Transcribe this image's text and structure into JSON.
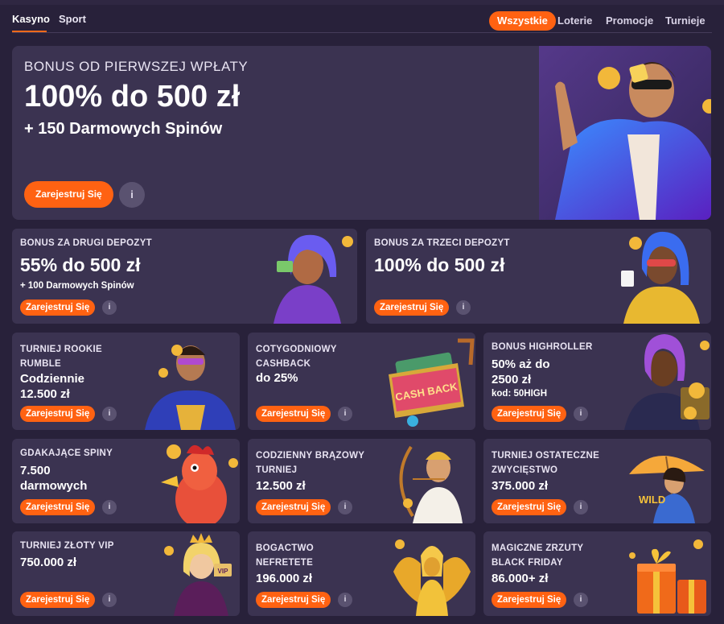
{
  "nav": {
    "tabs": [
      {
        "label": "Kasyno",
        "active": true
      },
      {
        "label": "Sport",
        "active": false
      }
    ],
    "filters": [
      {
        "label": "Wszystkie",
        "active": true
      },
      {
        "label": "Loterie",
        "active": false
      },
      {
        "label": "Promocje",
        "active": false
      },
      {
        "label": "Turnieje",
        "active": false
      }
    ]
  },
  "hero": {
    "title": "BONUS OD PIERWSZEJ WPŁATY",
    "amount": "100% do 500 zł",
    "sub": "+ 150 Darmowych Spinów",
    "button": "Zarejestruj Się",
    "info_icon": "info-icon"
  },
  "promos_row1": [
    {
      "title": "BONUS ZA DRUGI DEPOZYT",
      "amount": "55% do 500 zł",
      "sub": "+ 100 Darmowych Spinów",
      "button": "Zarejestruj Się"
    },
    {
      "title": "BONUS ZA TRZECI DEPOZYT",
      "amount": "100% do 500 zł",
      "sub": "",
      "button": "Zarejestruj Się"
    }
  ],
  "promos_grid": [
    {
      "title_1": "TURNIEJ ROOKIE",
      "title_2": "RUMBLE",
      "amount_1": "Codziennie",
      "amount_2": "12.500 zł",
      "extra": "",
      "button": "Zarejestruj Się"
    },
    {
      "title_1": "COTYGODNIOWY",
      "title_2": "CASHBACK",
      "amount_1": "do 25%",
      "amount_2": "",
      "extra": "",
      "button": "Zarejestruj Się",
      "art_text": "CASH BACK"
    },
    {
      "title_1": "BONUS HIGHROLLER",
      "title_2": "",
      "amount_1": "50% aż do",
      "amount_2": "2500 zł",
      "extra": "kod: 50HIGH",
      "button": "Zarejestruj Się"
    },
    {
      "title_1": "GDAKAJĄCE SPINY",
      "title_2": "",
      "amount_1": "7.500",
      "amount_2": "darmowych",
      "extra": "",
      "button": "Zarejestruj Się"
    },
    {
      "title_1": "CODZIENNY BRĄZOWY",
      "title_2": "TURNIEJ",
      "amount_1": "12.500 zł",
      "amount_2": "",
      "extra": "",
      "button": "Zarejestruj Się"
    },
    {
      "title_1": "TURNIEJ OSTATECZNE",
      "title_2": "ZWYCIĘSTWO",
      "amount_1": "375.000 zł",
      "amount_2": "",
      "extra": "",
      "button": "Zarejestruj Się",
      "art_text": "WILD"
    },
    {
      "title_1": "TURNIEJ ZŁOTY VIP",
      "title_2": "",
      "amount_1": "750.000 zł",
      "amount_2": "",
      "extra": "",
      "button": "Zarejestruj Się",
      "art_text": "VIP"
    },
    {
      "title_1": "BOGACTWO",
      "title_2": "NEFRETETE",
      "amount_1": "196.000 zł",
      "amount_2": "",
      "extra": "",
      "button": "Zarejestruj Się"
    },
    {
      "title_1": "MAGICZNE ZRZUTY",
      "title_2": "BLACK FRIDAY",
      "amount_1": "86.000+ zł",
      "amount_2": "",
      "extra": "",
      "button": "Zarejestruj Się"
    }
  ],
  "colors": {
    "background": "#28213a",
    "card": "#3b3351",
    "accent": "#ff6212",
    "info": "#5a5270"
  }
}
